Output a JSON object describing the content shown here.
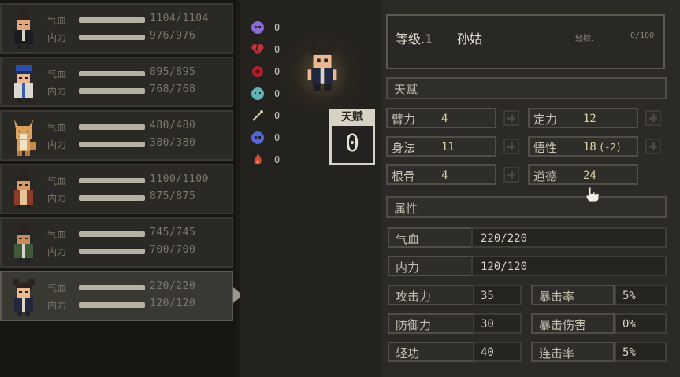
{
  "party": {
    "members": [
      {
        "hp_label": "气血",
        "hp": "1104/1104",
        "hp_frac": 1.0,
        "mp_label": "内力",
        "mp": "976/976",
        "mp_frac": 1.0,
        "portrait": "warrior-topknot-portrait-icon"
      },
      {
        "hp_label": "气血",
        "hp": "895/895",
        "hp_frac": 1.0,
        "mp_label": "内力",
        "mp": "768/768",
        "mp_frac": 1.0,
        "portrait": "scholar-blue-hat-portrait-icon"
      },
      {
        "hp_label": "气血",
        "hp": "480/480",
        "hp_frac": 1.0,
        "mp_label": "内力",
        "mp": "380/380",
        "mp_frac": 1.0,
        "portrait": "fox-portrait-icon"
      },
      {
        "hp_label": "气血",
        "hp": "1100/1100",
        "hp_frac": 1.0,
        "mp_label": "内力",
        "mp": "875/875",
        "mp_frac": 1.0,
        "portrait": "monk-warrior-portrait-icon"
      },
      {
        "hp_label": "气血",
        "hp": "745/745",
        "hp_frac": 1.0,
        "mp_label": "内力",
        "mp": "700/700",
        "mp_frac": 1.0,
        "portrait": "green-robe-warrior-portrait-icon"
      },
      {
        "hp_label": "气血",
        "hp": "220/220",
        "hp_frac": 1.0,
        "mp_label": "内力",
        "mp": "120/120",
        "mp_frac": 1.0,
        "portrait": "girl-twin-buns-portrait-icon"
      }
    ],
    "selected_index": 5
  },
  "status_effects": [
    {
      "icon": "purple-skull-icon",
      "value": "0",
      "color": "#8a6bd6"
    },
    {
      "icon": "broken-heart-icon",
      "value": "0",
      "color": "#c8323a"
    },
    {
      "icon": "red-burst-icon",
      "value": "0",
      "color": "#b4202a"
    },
    {
      "icon": "teal-ghost-icon",
      "value": "0",
      "color": "#5fb3b5"
    },
    {
      "icon": "needle-icon",
      "value": "0",
      "color": "#d8cfa5"
    },
    {
      "icon": "blue-skull-icon",
      "value": "0",
      "color": "#5566d4"
    },
    {
      "icon": "flame-icon",
      "value": "0",
      "color": "#d04a30"
    }
  ],
  "talent": {
    "label": "天赋",
    "value": "0"
  },
  "character": {
    "level_label": "等级.1",
    "name": "孙姑",
    "exp_label": "经验.",
    "exp_value": "0/100"
  },
  "talents_section": {
    "title": "天赋"
  },
  "base_stats": [
    {
      "label": "臂力",
      "value": "4",
      "has_plus": true
    },
    {
      "label": "定力",
      "value": "12",
      "has_plus": true
    },
    {
      "label": "身法",
      "value": "11",
      "has_plus": true
    },
    {
      "label": "悟性",
      "value": "18",
      "modifier": "(-2)",
      "has_plus": true
    },
    {
      "label": "根骨",
      "value": "4",
      "has_plus": true
    },
    {
      "label": "道德",
      "value": "24",
      "has_plus": false
    }
  ],
  "attributes_section": {
    "title": "属性"
  },
  "attributes": {
    "hp": {
      "label": "气血",
      "value": "220/220"
    },
    "mp": {
      "label": "内力",
      "value": "120/120"
    },
    "grid": [
      {
        "label": "攻击力",
        "value": "35"
      },
      {
        "label": "暴击率",
        "value": "5%"
      },
      {
        "label": "防御力",
        "value": "30"
      },
      {
        "label": "暴击伤害",
        "value": "0%"
      },
      {
        "label": "轻功",
        "value": "40"
      },
      {
        "label": "连击率",
        "value": "5%"
      }
    ]
  },
  "colors": {
    "accent_value": "#ddd0a0",
    "panel_bg": "#2c2a26",
    "selected_bg": "#3a3833"
  }
}
